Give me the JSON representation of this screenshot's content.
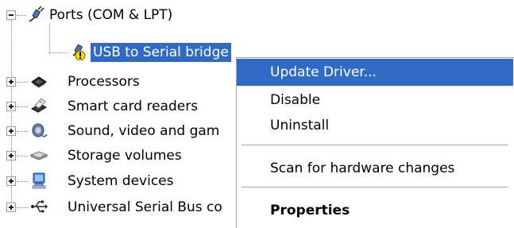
{
  "tree": {
    "ports": {
      "label": "Ports (COM & LPT)",
      "icon": "port-connector-icon",
      "expanded": true,
      "child": {
        "label": "USB to Serial bridge",
        "icon": "warning-device-icon",
        "selected": true
      }
    },
    "items": [
      {
        "label": "Processors",
        "icon": "processor-chip-icon"
      },
      {
        "label": "Smart card readers",
        "icon": "smart-card-reader-icon"
      },
      {
        "label": "Sound, video and gam",
        "icon": "speaker-icon"
      },
      {
        "label": "Storage volumes",
        "icon": "disk-drive-icon"
      },
      {
        "label": "System devices",
        "icon": "computer-monitor-icon"
      },
      {
        "label": "Universal Serial Bus co",
        "icon": "usb-icon"
      }
    ]
  },
  "context_menu": {
    "items": [
      {
        "label": "Update Driver...",
        "highlighted": true
      },
      {
        "label": "Disable"
      },
      {
        "label": "Uninstall"
      },
      {
        "label": "Scan for hardware changes"
      },
      {
        "label": "Properties",
        "bold": true
      }
    ]
  },
  "colors": {
    "selection": "#316ac5",
    "warning": "#f5d400"
  }
}
